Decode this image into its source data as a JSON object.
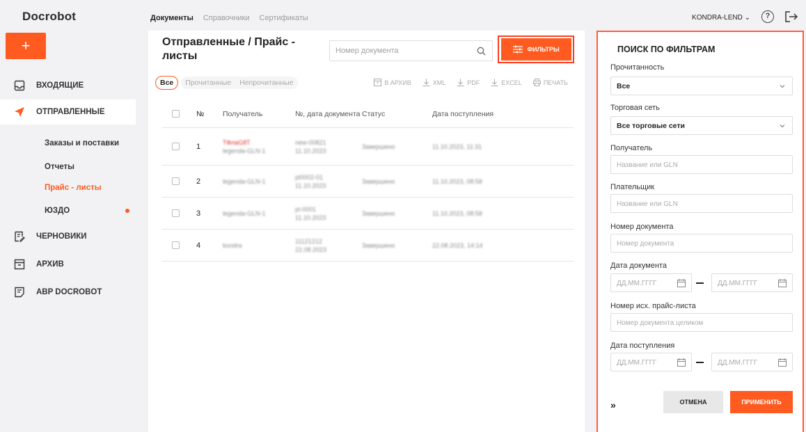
{
  "brand": {
    "logo": "Docrobot",
    "accent": "#ff5a1f"
  },
  "topnav": {
    "items": [
      "Документы",
      "Справочники",
      "Сертификаты"
    ],
    "active": "Документы"
  },
  "header": {
    "user": "KONDRA-LEND ⌄",
    "help": "?"
  },
  "sidebar": {
    "plus": "+",
    "items": [
      {
        "label": "ВХОДЯЩИЕ",
        "icon": "inbox-icon"
      },
      {
        "label": "ОТПРАВЛЕННЫЕ",
        "icon": "send-icon"
      },
      {
        "label": "ЧЕРНОВИКИ",
        "icon": "draft-icon"
      },
      {
        "label": "АРХИВ",
        "icon": "archive-icon"
      },
      {
        "label": "ABP DOCROBOT",
        "icon": "document-icon"
      }
    ],
    "subitems": [
      {
        "label": "Заказы и поставки"
      },
      {
        "label": "Отчеты"
      },
      {
        "label": "Прайс - листы",
        "active": true
      },
      {
        "label": "ЮЗДО",
        "badge_dot": true
      }
    ]
  },
  "main": {
    "title": "Отправленные / Прайс - листы",
    "search_placeholder": "Номер документа",
    "filters_button": "ФИЛЬТРЫ",
    "chips": [
      "Все",
      "Прочитанные",
      "Непрочитанные"
    ],
    "actions": [
      "В АРХИВ",
      "XML",
      "PDF",
      "EXCEL",
      "ПЕЧАТЬ"
    ],
    "columns": [
      "№",
      "Получатель",
      "№, дата документа",
      "Статус",
      "Дата поступления"
    ],
    "rows": [
      {
        "num": "1",
        "recipient_top": "ТФлаG8T",
        "recipient": "legenda-GLN-1",
        "doc_no": "new-00821",
        "doc_date": "11.10.2023",
        "status": "Завершено",
        "received": "11.10.2023, 11:31"
      },
      {
        "num": "2",
        "recipient_top": "",
        "recipient": "legenda-GLN-1",
        "doc_no": "pl0002-01",
        "doc_date": "11.10.2023",
        "status": "Завершено",
        "received": "11.10.2023, 08:58"
      },
      {
        "num": "3",
        "recipient_top": "",
        "recipient": "legenda-GLN-1",
        "doc_no": "pl-0001",
        "doc_date": "11.10.2023",
        "status": "Завершено",
        "received": "11.10.2023, 08:58"
      },
      {
        "num": "4",
        "recipient_top": "",
        "recipient": "kondra",
        "doc_no": "11121212",
        "doc_date": "22.08.2023",
        "status": "Завершено",
        "received": "22.08.2023, 14:14"
      }
    ]
  },
  "filter_panel": {
    "title": "ПОИСК ПО ФИЛЬТРАМ",
    "read_label": "Прочитанность",
    "read_value": "Все",
    "chain_label": "Торговая сеть",
    "chain_value": "Все торговые сети",
    "recipient_label": "Получатель",
    "recipient_placeholder": "Название или GLN",
    "payer_label": "Плательщик",
    "payer_placeholder": "Название или GLN",
    "docnum_label": "Номер документа",
    "docnum_placeholder": "Номер документа",
    "docdate_label": "Дата документа",
    "date_placeholder": "ДД.ММ.ГГГГ",
    "pricelist_label": "Номер исх. прайс-листа",
    "pricelist_placeholder": "Номер документа целиком",
    "received_label": "Дата поступления",
    "collapse": "»",
    "cancel": "ОТМЕНА",
    "apply": "ПРИМЕНИТЬ"
  }
}
